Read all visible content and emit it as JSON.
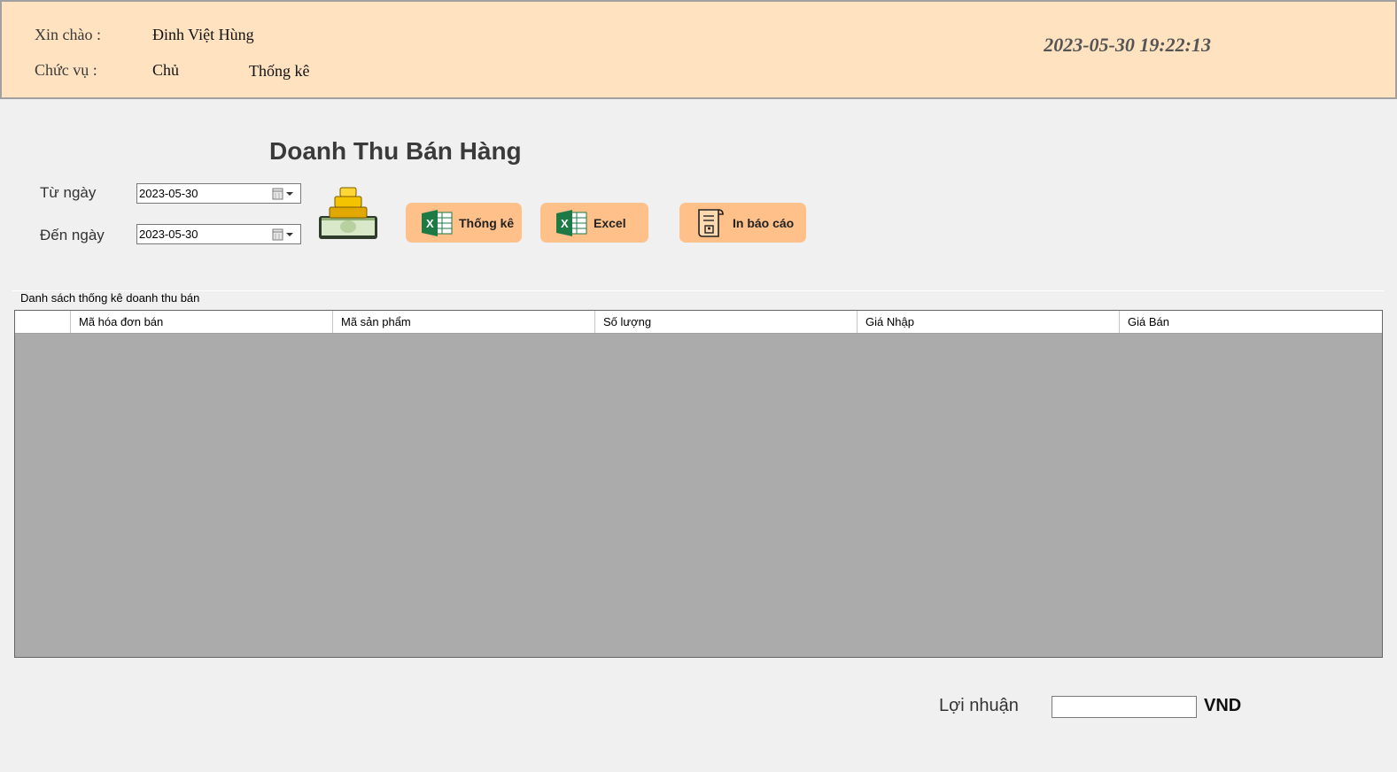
{
  "header": {
    "greeting_label": "Xin chào :",
    "user_name": "Đinh Việt Hùng",
    "role_label": "Chức vụ :",
    "role_value": "Chủ",
    "section": "Thống kê",
    "datetime": "2023-05-30 19:22:13"
  },
  "page": {
    "title": "Doanh Thu Bán Hàng"
  },
  "filters": {
    "from_label": "Từ ngày",
    "from_value": "2023-05-30",
    "to_label": "Đến ngày",
    "to_value": "2023-05-30"
  },
  "buttons": {
    "stats_label": "Thống kê",
    "excel_label": "Excel",
    "print_label": "In báo cáo"
  },
  "group": {
    "legend": "Danh sách thống kê doanh thu bán",
    "columns": [
      "Mã hóa đơn bán",
      "Mã sản phẩm",
      "Số lượng",
      "Giá Nhập",
      "Giá Bán"
    ],
    "rows": []
  },
  "profit": {
    "label": "Lợi nhuận",
    "value": "",
    "unit": "VND"
  },
  "colors": {
    "header_bg": "#ffe2c0",
    "button_bg": "#ffc08a",
    "grid_bg": "#ababab",
    "excel_green": "#1d7a45"
  },
  "icons": [
    "calendar-icon",
    "money-stack-icon",
    "excel-icon",
    "report-icon"
  ]
}
